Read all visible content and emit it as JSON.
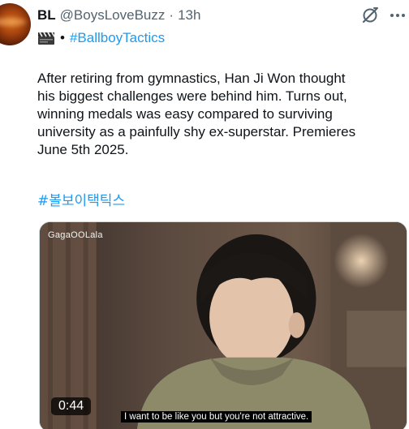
{
  "author": {
    "display_name": "BL",
    "handle": "@BoysLoveBuzz",
    "separator": "·",
    "time": "13h"
  },
  "header_icons": {
    "grok": "grok-icon",
    "more": "more-icon"
  },
  "tagline": {
    "emoji": "clapper-board-icon",
    "dot": "•",
    "hashtag": "#BallboyTactics"
  },
  "body": {
    "lines": [
      "After retiring from gymnastics, Han Ji Won thought",
      "his biggest challenges were behind him. Turns out,",
      "winning medals was easy compared to surviving",
      "university as a painfully shy ex-superstar. Premieres",
      "June 5th 2025."
    ]
  },
  "hashtag_korean": "#볼보이택틱스",
  "video": {
    "watermark": "GagaOOLala",
    "duration": "0:44",
    "subtitle": "I want to be like you but you're not attractive."
  },
  "colors": {
    "link": "#1d9bf0",
    "secondary_text": "#536471",
    "primary_text": "#0f1419"
  }
}
